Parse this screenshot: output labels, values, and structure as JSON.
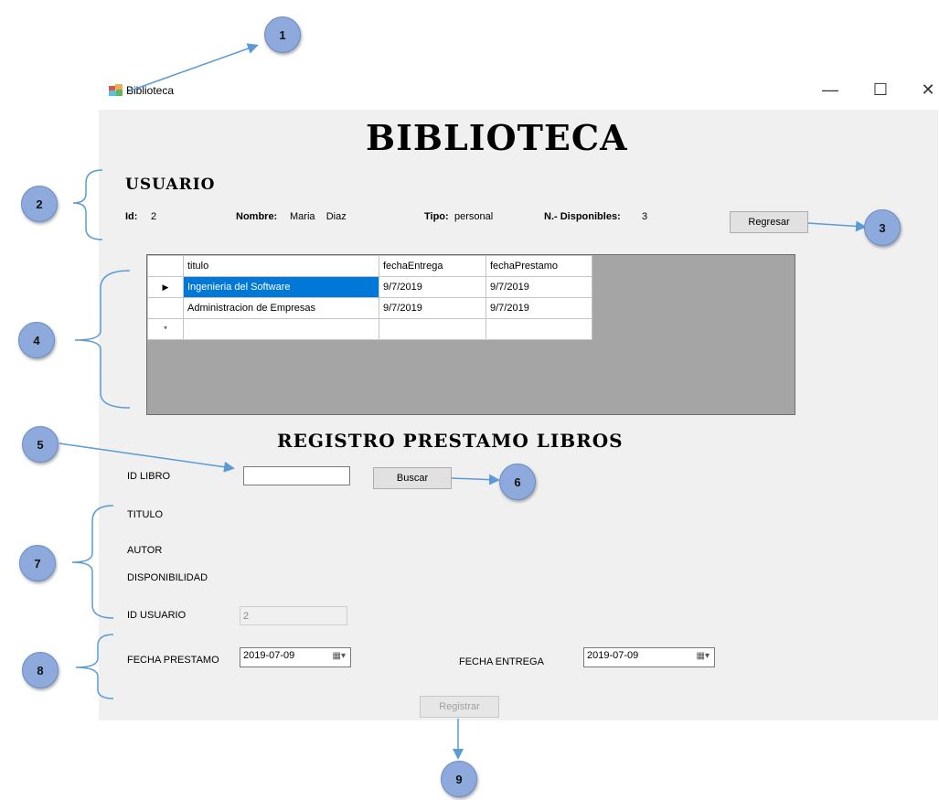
{
  "window": {
    "title": "Biblioteca",
    "controls": {
      "minimize": "—",
      "maximize": "☐",
      "close": "✕"
    }
  },
  "header": {
    "title": "BIBLIOTECA"
  },
  "usuario": {
    "section_title": "USUARIO",
    "id_label": "Id:",
    "id_value": "2",
    "nombre_label": "Nombre:",
    "nombre_value": "Maria    Diaz",
    "tipo_label": "Tipo:",
    "tipo_value": "personal",
    "disponibles_label": "N.- Disponibles:",
    "disponibles_value": "3",
    "regresar_label": "Regresar"
  },
  "grid": {
    "columns": [
      "titulo",
      "fechaEntrega",
      "fechaPrestamo"
    ],
    "rows": [
      {
        "marker": "▶",
        "titulo": "Ingenieria del Software",
        "fechaEntrega": "9/7/2019",
        "fechaPrestamo": "9/7/2019",
        "selected": true
      },
      {
        "marker": "",
        "titulo": "Administracion de Empresas",
        "fechaEntrega": "9/7/2019",
        "fechaPrestamo": "9/7/2019",
        "selected": false
      }
    ],
    "new_row_marker": "*"
  },
  "registro": {
    "title": "REGISTRO PRESTAMO LIBROS",
    "id_libro_label": "ID LIBRO",
    "id_libro_value": "",
    "buscar_label": "Buscar",
    "titulo_label": "TITULO",
    "autor_label": "AUTOR",
    "disponibilidad_label": "DISPONIBILIDAD",
    "id_usuario_label": "ID USUARIO",
    "id_usuario_value": "2",
    "fecha_prestamo_label": "FECHA PRESTAMO",
    "fecha_prestamo_value": "2019-07-09",
    "fecha_entrega_label": "FECHA ENTREGA",
    "fecha_entrega_value": "2019-07-09",
    "registrar_label": "Registrar"
  },
  "callouts": [
    "1",
    "2",
    "3",
    "4",
    "5",
    "6",
    "7",
    "8",
    "9"
  ],
  "colors": {
    "callout_fill": "#8ea9db",
    "arrow": "#5b9bd5",
    "selection": "#0078d7",
    "form_bg": "#f0f0f0"
  }
}
